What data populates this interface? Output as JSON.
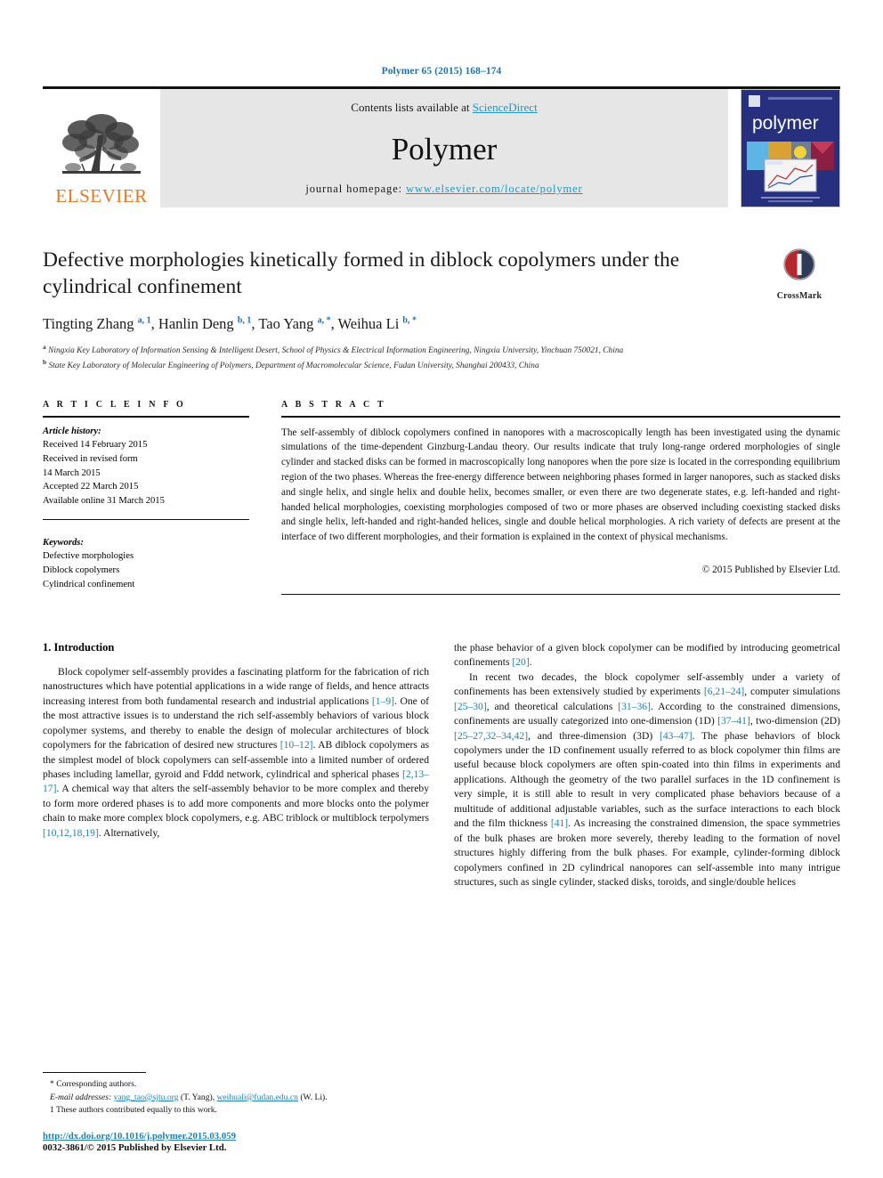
{
  "running_head": "Polymer 65 (2015) 168–174",
  "masthead": {
    "contents_prefix": "Contents lists available at ",
    "sciencedirect": "ScienceDirect",
    "journal_name": "Polymer",
    "homepage_prefix": "journal homepage: ",
    "homepage_url": "www.elsevier.com/locate/polymer",
    "publisher_wordmark": "ELSEVIER",
    "cover_title": "polymer",
    "accent_blue": "#2196c4",
    "elsevier_orange": "#E87722",
    "cover_blue": "#26307e"
  },
  "article": {
    "title": "Defective morphologies kinetically formed in diblock copolymers under the cylindrical confinement",
    "crossmark_label": "CrossMark",
    "authors_html": "Tingting Zhang <sup>a, 1</sup>, Hanlin Deng <sup>b, 1</sup>, Tao Yang <sup>a, *</sup>, Weihua Li <sup>b, *</sup>",
    "affiliations": [
      {
        "mark": "a",
        "text": "Ningxia Key Laboratory of Information Sensing & Intelligent Desert, School of Physics & Electrical Information Engineering, Ningxia University, Yinchuan 750021, China"
      },
      {
        "mark": "b",
        "text": "State Key Laboratory of Molecular Engineering of Polymers, Department of Macromolecular Science, Fudan University, Shanghai 200433, China"
      }
    ]
  },
  "info": {
    "heading": "A R T I C L E   I N F O",
    "history_label": "Article history:",
    "history": [
      "Received 14 February 2015",
      "Received in revised form",
      "14 March 2015",
      "Accepted 22 March 2015",
      "Available online 31 March 2015"
    ],
    "keywords_label": "Keywords:",
    "keywords": [
      "Defective morphologies",
      "Diblock copolymers",
      "Cylindrical confinement"
    ]
  },
  "abstract": {
    "heading": "A B S T R A C T",
    "text": "The self-assembly of diblock copolymers confined in nanopores with a macroscopically length has been investigated using the dynamic simulations of the time-dependent Ginzburg-Landau theory. Our results indicate that truly long-range ordered morphologies of single cylinder and stacked disks can be formed in macroscopically long nanopores when the pore size is located in the corresponding equilibrium region of the two phases. Whereas the free-energy difference between neighboring phases formed in larger nanopores, such as stacked disks and single helix, and single helix and double helix, becomes smaller, or even there are two degenerate states, e.g. left-handed and right-handed helical morphologies, coexisting morphologies composed of two or more phases are observed including coexisting stacked disks and single helix, left-handed and right-handed helices, single and double helical morphologies. A rich variety of defects are present at the interface of two different morphologies, and their formation is explained in the context of physical mechanisms.",
    "copyright": "© 2015 Published by Elsevier Ltd."
  },
  "body": {
    "section_title": "1. Introduction",
    "left_paragraphs": [
      "Block copolymer self-assembly provides a fascinating platform for the fabrication of rich nanostructures which have potential applications in a wide range of fields, and hence attracts increasing interest from both fundamental research and industrial applications [1–9]. One of the most attractive issues is to understand the rich self-assembly behaviors of various block copolymer systems, and thereby to enable the design of molecular architectures of block copolymers for the fabrication of desired new structures [10–12]. AB diblock copolymers as the simplest model of block copolymers can self-assemble into a limited number of ordered phases including lamellar, gyroid and Fddd network, cylindrical and spherical phases [2,13–17]. A chemical way that alters the self-assembly behavior to be more complex and thereby to form more ordered phases is to add more components and more blocks onto the polymer chain to make more complex block copolymers, e.g. ABC triblock or multiblock terpolymers [10,12,18,19]. Alternatively,"
    ],
    "right_paragraphs": [
      "the phase behavior of a given block copolymer can be modified by introducing geometrical confinements [20].",
      "In recent two decades, the block copolymer self-assembly under a variety of confinements has been extensively studied by experiments [6,21–24], computer simulations [25–30], and theoretical calculations [31–36]. According to the constrained dimensions, confinements are usually categorized into one-dimension (1D) [37–41], two-dimension (2D) [25–27,32–34,42], and three-dimension (3D) [43–47]. The phase behaviors of block copolymers under the 1D confinement usually referred to as block copolymer thin films are useful because block copolymers are often spin-coated into thin films in experiments and applications. Although the geometry of the two parallel surfaces in the 1D confinement is very simple, it is still able to result in very complicated phase behaviors because of a multitude of additional adjustable variables, such as the surface interactions to each block and the film thickness [41]. As increasing the constrained dimension, the space symmetries of the bulk phases are broken more severely, thereby leading to the formation of novel structures highly differing from the bulk phases. For example, cylinder-forming diblock copolymers confined in 2D cylindrical nanopores can self-assemble into many intrigue structures, such as single cylinder, stacked disks, toroids, and single/double helices"
    ]
  },
  "footnotes": {
    "corresponding": "* Corresponding authors.",
    "email_label": "E-mail addresses:",
    "email1": "yang_tao@sjtu.org",
    "email1_who": " (T. Yang), ",
    "email2": "weihuali@fudan.edu.cn",
    "email2_who": " (W. Li).",
    "equal_contrib": "1 These authors contributed equally to this work.",
    "doi": "http://dx.doi.org/10.1016/j.polymer.2015.03.059",
    "issn_line": "0032-3861/© 2015 Published by Elsevier Ltd."
  }
}
